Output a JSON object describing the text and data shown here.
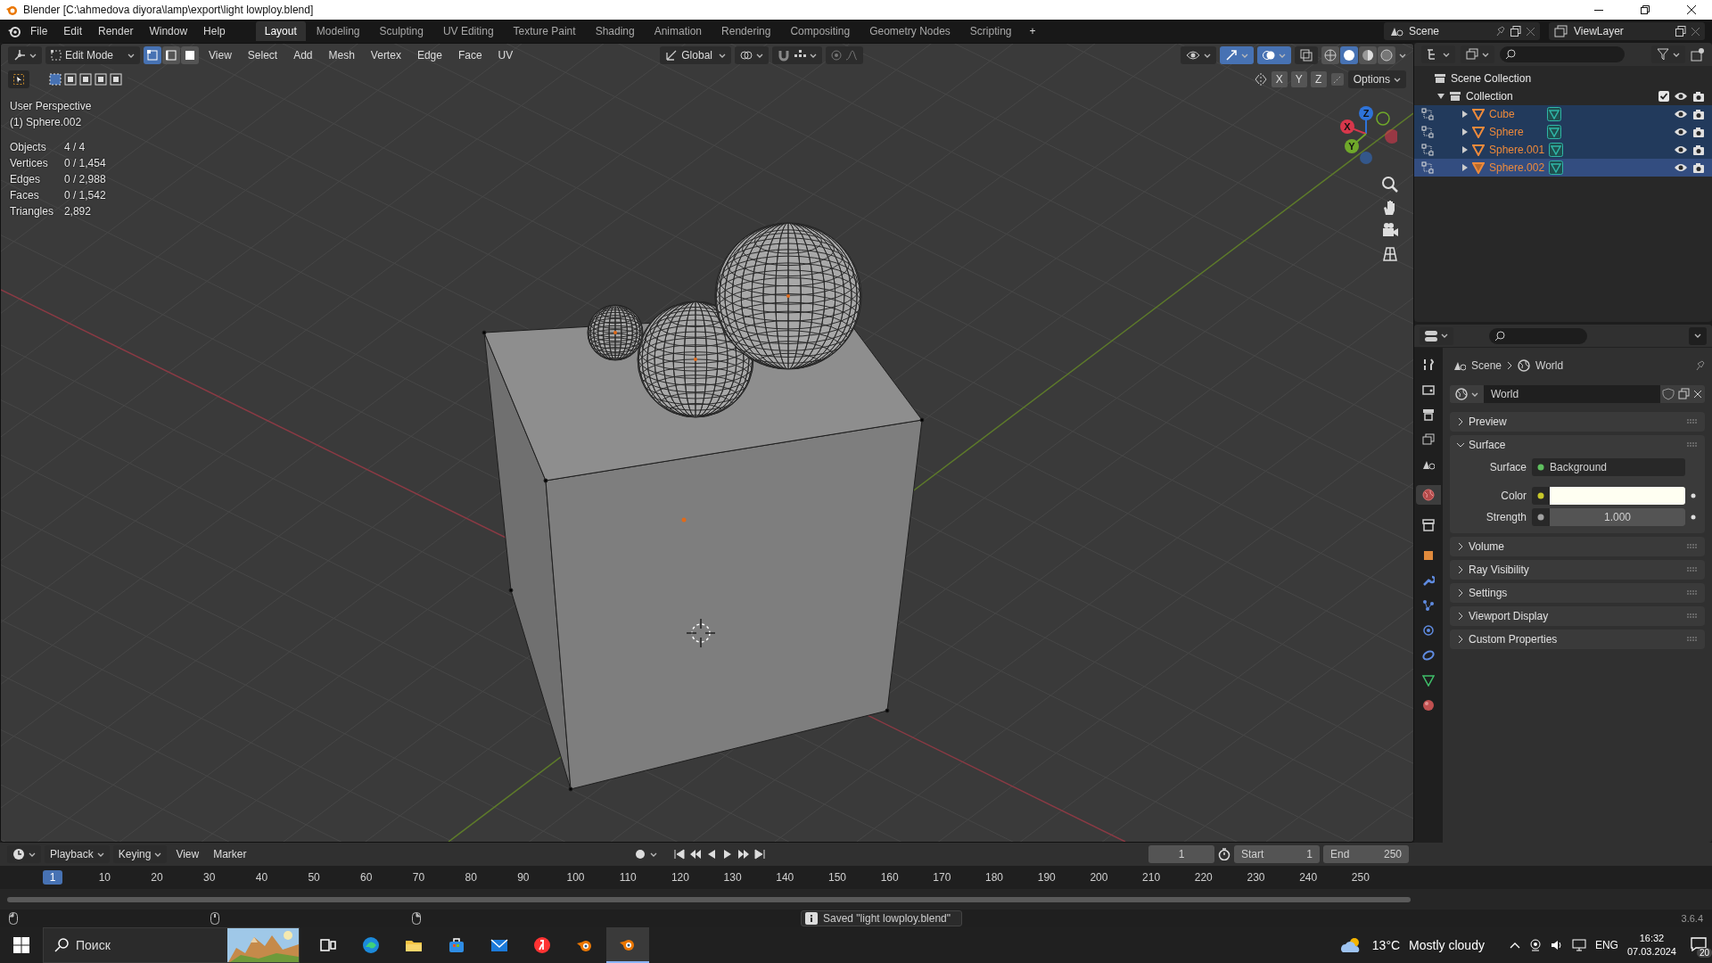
{
  "window": {
    "title": "Blender [C:\\ahmedova diyora\\lamp\\export\\light lowploy.blend]"
  },
  "menu": [
    "File",
    "Edit",
    "Render",
    "Window",
    "Help"
  ],
  "workspaces": [
    {
      "label": "Layout",
      "selected": true
    },
    {
      "label": "Modeling",
      "selected": false
    },
    {
      "label": "Sculpting",
      "selected": false
    },
    {
      "label": "UV Editing",
      "selected": false
    },
    {
      "label": "Texture Paint",
      "selected": false
    },
    {
      "label": "Shading",
      "selected": false
    },
    {
      "label": "Animation",
      "selected": false
    },
    {
      "label": "Rendering",
      "selected": false
    },
    {
      "label": "Compositing",
      "selected": false
    },
    {
      "label": "Geometry Nodes",
      "selected": false
    },
    {
      "label": "Scripting",
      "selected": false
    }
  ],
  "add_workspace": "+",
  "scene": "Scene",
  "view_layer": "ViewLayer",
  "viewport": {
    "mode": "Edit Mode",
    "select_modes": [
      {
        "selected": true
      },
      {
        "selected": false
      },
      {
        "selected": false
      }
    ],
    "menus": [
      "View",
      "Select",
      "Add",
      "Mesh",
      "Vertex",
      "Edge",
      "Face",
      "UV"
    ],
    "orientation": "Global",
    "shading": [
      {
        "selected": false
      },
      {
        "selected": true
      },
      {
        "selected": false
      },
      {
        "selected": false
      }
    ],
    "mirror_axes": [
      "X",
      "Y",
      "Z"
    ],
    "options": "Options",
    "view_name": "User Perspective",
    "active_object": "(1) Sphere.002",
    "stats": [
      {
        "label": "Objects",
        "value": "4 / 4"
      },
      {
        "label": "Vertices",
        "value": "0 / 1,454"
      },
      {
        "label": "Edges",
        "value": "0 / 2,988"
      },
      {
        "label": "Faces",
        "value": "0 / 1,542"
      },
      {
        "label": "Triangles",
        "value": "2,892"
      }
    ],
    "gizmo_axes": [
      {
        "label": "Z",
        "color": "#2e73d9"
      },
      {
        "label": "X",
        "color": "#d7374b"
      },
      {
        "label": "Y",
        "color": "#6fa82a"
      }
    ]
  },
  "outliner": {
    "root": "Scene Collection",
    "collection": {
      "name": "Collection",
      "expanded": true,
      "checked": true,
      "children": [
        {
          "name": "Cube",
          "selected": true,
          "active": false
        },
        {
          "name": "Sphere",
          "selected": true,
          "active": false
        },
        {
          "name": "Sphere.001",
          "selected": true,
          "active": false
        },
        {
          "name": "Sphere.002",
          "selected": true,
          "active": true
        }
      ]
    }
  },
  "properties": {
    "tabs": [
      {
        "kind": "tool",
        "selected": false
      },
      {
        "kind": "render",
        "selected": false
      },
      {
        "kind": "output",
        "selected": false
      },
      {
        "kind": "view_layer",
        "selected": false
      },
      {
        "kind": "scene",
        "selected": false
      },
      {
        "kind": "world",
        "selected": true
      },
      {
        "kind": "collection",
        "selected": false
      },
      {
        "kind": "object",
        "selected": false
      },
      {
        "kind": "modifier",
        "selected": false
      },
      {
        "kind": "particles",
        "selected": false
      },
      {
        "kind": "physics",
        "selected": false
      },
      {
        "kind": "constraint",
        "selected": false
      },
      {
        "kind": "data",
        "selected": false
      },
      {
        "kind": "material",
        "selected": false
      }
    ],
    "breadcrumb": [
      "Scene",
      "World"
    ],
    "datablock": "World",
    "panels": [
      {
        "label": "Preview",
        "expanded": false
      },
      {
        "label": "Surface",
        "expanded": true,
        "fields": [
          {
            "kind": "shader",
            "label": "Surface",
            "value": "Background"
          },
          {
            "kind": "color",
            "label": "Color",
            "color": "#fffff2"
          },
          {
            "kind": "number",
            "label": "Strength",
            "value": "1.000"
          }
        ]
      },
      {
        "label": "Volume",
        "expanded": false
      },
      {
        "label": "Ray Visibility",
        "expanded": false
      },
      {
        "label": "Settings",
        "expanded": false
      },
      {
        "label": "Viewport Display",
        "expanded": false
      },
      {
        "label": "Custom Properties",
        "expanded": false
      }
    ]
  },
  "timeline": {
    "menus": [
      "Playback",
      "Keying",
      "View",
      "Marker"
    ],
    "current_frame": "1",
    "ruler_current_frame": "1",
    "start_label": "Start",
    "start": "1",
    "end_label": "End",
    "end": "250",
    "ticks": [
      "10",
      "20",
      "30",
      "40",
      "50",
      "60",
      "70",
      "80",
      "90",
      "100",
      "110",
      "120",
      "130",
      "140",
      "150",
      "160",
      "170",
      "180",
      "190",
      "200",
      "210",
      "220",
      "230",
      "240",
      "250"
    ]
  },
  "status_bar": {
    "message": "Saved \"light lowploy.blend\"",
    "version": "3.6.4"
  },
  "taskbar": {
    "search": {
      "placeholder": "Поиск"
    },
    "apps": [
      {
        "kind": "task_view",
        "selected": false
      },
      {
        "kind": "edge",
        "selected": false
      },
      {
        "kind": "explorer",
        "selected": false
      },
      {
        "kind": "store",
        "selected": false
      },
      {
        "kind": "mail",
        "selected": false
      },
      {
        "kind": "yandex",
        "selected": false
      },
      {
        "kind": "blender",
        "selected": false
      },
      {
        "kind": "blender",
        "selected": true
      }
    ],
    "temperature": "13°C",
    "weather": "Mostly cloudy",
    "language": "ENG",
    "time": "16:32",
    "date": "07.03.2024",
    "notifications": "20"
  }
}
